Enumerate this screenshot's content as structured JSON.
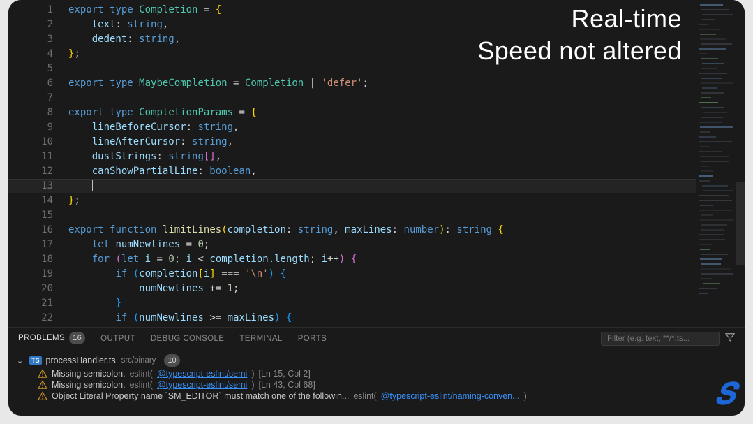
{
  "overlay": {
    "line1": "Real-time",
    "line2": "Speed not altered"
  },
  "editor": {
    "line_start": 1,
    "line_end": 22,
    "current_line": 13,
    "lines": [
      {
        "n": 1,
        "tokens": [
          [
            "kw",
            "export"
          ],
          [
            "punct",
            " "
          ],
          [
            "typekw",
            "type"
          ],
          [
            "punct",
            " "
          ],
          [
            "type",
            "Completion"
          ],
          [
            "punct",
            " = "
          ],
          [
            "bracket1",
            "{"
          ]
        ]
      },
      {
        "n": 2,
        "tokens": [
          [
            "punct",
            "    "
          ],
          [
            "ident",
            "text"
          ],
          [
            "punct",
            ": "
          ],
          [
            "typekw",
            "string"
          ],
          [
            "punct",
            ","
          ]
        ]
      },
      {
        "n": 3,
        "tokens": [
          [
            "punct",
            "    "
          ],
          [
            "ident",
            "dedent"
          ],
          [
            "punct",
            ": "
          ],
          [
            "typekw",
            "string"
          ],
          [
            "punct",
            ","
          ]
        ]
      },
      {
        "n": 4,
        "tokens": [
          [
            "bracket1",
            "}"
          ],
          [
            "punct",
            ";"
          ]
        ]
      },
      {
        "n": 5,
        "tokens": []
      },
      {
        "n": 6,
        "tokens": [
          [
            "kw",
            "export"
          ],
          [
            "punct",
            " "
          ],
          [
            "typekw",
            "type"
          ],
          [
            "punct",
            " "
          ],
          [
            "type",
            "MaybeCompletion"
          ],
          [
            "punct",
            " = "
          ],
          [
            "type",
            "Completion"
          ],
          [
            "punct",
            " | "
          ],
          [
            "str",
            "'defer'"
          ],
          [
            "punct",
            ";"
          ]
        ]
      },
      {
        "n": 7,
        "tokens": []
      },
      {
        "n": 8,
        "tokens": [
          [
            "kw",
            "export"
          ],
          [
            "punct",
            " "
          ],
          [
            "typekw",
            "type"
          ],
          [
            "punct",
            " "
          ],
          [
            "type",
            "CompletionParams"
          ],
          [
            "punct",
            " = "
          ],
          [
            "bracket1",
            "{"
          ]
        ]
      },
      {
        "n": 9,
        "tokens": [
          [
            "punct",
            "    "
          ],
          [
            "ident",
            "lineBeforeCursor"
          ],
          [
            "punct",
            ": "
          ],
          [
            "typekw",
            "string"
          ],
          [
            "punct",
            ","
          ]
        ]
      },
      {
        "n": 10,
        "tokens": [
          [
            "punct",
            "    "
          ],
          [
            "ident",
            "lineAfterCursor"
          ],
          [
            "punct",
            ": "
          ],
          [
            "typekw",
            "string"
          ],
          [
            "punct",
            ","
          ]
        ]
      },
      {
        "n": 11,
        "tokens": [
          [
            "punct",
            "    "
          ],
          [
            "ident",
            "dustStrings"
          ],
          [
            "punct",
            ": "
          ],
          [
            "typekw",
            "string"
          ],
          [
            "bracket2",
            "["
          ],
          [
            "bracket2",
            "]"
          ],
          [
            "punct",
            ","
          ]
        ]
      },
      {
        "n": 12,
        "tokens": [
          [
            "punct",
            "    "
          ],
          [
            "ident",
            "canShowPartialLine"
          ],
          [
            "punct",
            ": "
          ],
          [
            "typekw",
            "boolean"
          ],
          [
            "punct",
            ","
          ]
        ]
      },
      {
        "n": 13,
        "tokens": [
          [
            "punct",
            "    "
          ]
        ],
        "cursor": true
      },
      {
        "n": 14,
        "tokens": [
          [
            "bracket1",
            "}"
          ],
          [
            "punct",
            ";"
          ]
        ]
      },
      {
        "n": 15,
        "tokens": []
      },
      {
        "n": 16,
        "tokens": [
          [
            "kw",
            "export"
          ],
          [
            "punct",
            " "
          ],
          [
            "kw",
            "function"
          ],
          [
            "punct",
            " "
          ],
          [
            "fn",
            "limitLines"
          ],
          [
            "bracket1",
            "("
          ],
          [
            "ident",
            "completion"
          ],
          [
            "punct",
            ": "
          ],
          [
            "typekw",
            "string"
          ],
          [
            "punct",
            ", "
          ],
          [
            "ident",
            "maxLines"
          ],
          [
            "punct",
            ": "
          ],
          [
            "typekw",
            "number"
          ],
          [
            "bracket1",
            ")"
          ],
          [
            "punct",
            ": "
          ],
          [
            "typekw",
            "string"
          ],
          [
            "punct",
            " "
          ],
          [
            "bracket1",
            "{"
          ]
        ]
      },
      {
        "n": 17,
        "tokens": [
          [
            "punct",
            "    "
          ],
          [
            "kw",
            "let"
          ],
          [
            "punct",
            " "
          ],
          [
            "ident",
            "numNewlines"
          ],
          [
            "punct",
            " = "
          ],
          [
            "num",
            "0"
          ],
          [
            "punct",
            ";"
          ]
        ]
      },
      {
        "n": 18,
        "tokens": [
          [
            "punct",
            "    "
          ],
          [
            "kw",
            "for"
          ],
          [
            "punct",
            " "
          ],
          [
            "bracket2",
            "("
          ],
          [
            "kw",
            "let"
          ],
          [
            "punct",
            " "
          ],
          [
            "ident",
            "i"
          ],
          [
            "punct",
            " = "
          ],
          [
            "num",
            "0"
          ],
          [
            "punct",
            "; "
          ],
          [
            "ident",
            "i"
          ],
          [
            "punct",
            " < "
          ],
          [
            "ident",
            "completion"
          ],
          [
            "punct",
            "."
          ],
          [
            "ident",
            "length"
          ],
          [
            "punct",
            "; "
          ],
          [
            "ident",
            "i"
          ],
          [
            "punct",
            "++"
          ],
          [
            "bracket2",
            ")"
          ],
          [
            "punct",
            " "
          ],
          [
            "bracket2",
            "{"
          ]
        ]
      },
      {
        "n": 19,
        "tokens": [
          [
            "punct",
            "        "
          ],
          [
            "kw",
            "if"
          ],
          [
            "punct",
            " "
          ],
          [
            "bracket3",
            "("
          ],
          [
            "ident",
            "completion"
          ],
          [
            "bracket1",
            "["
          ],
          [
            "ident",
            "i"
          ],
          [
            "bracket1",
            "]"
          ],
          [
            "punct",
            " === "
          ],
          [
            "str",
            "'\\n'"
          ],
          [
            "bracket3",
            ")"
          ],
          [
            "punct",
            " "
          ],
          [
            "bracket3",
            "{"
          ]
        ]
      },
      {
        "n": 20,
        "tokens": [
          [
            "punct",
            "            "
          ],
          [
            "ident",
            "numNewlines"
          ],
          [
            "punct",
            " += "
          ],
          [
            "num",
            "1"
          ],
          [
            "punct",
            ";"
          ]
        ]
      },
      {
        "n": 21,
        "tokens": [
          [
            "punct",
            "        "
          ],
          [
            "bracket3",
            "}"
          ]
        ]
      },
      {
        "n": 22,
        "tokens": [
          [
            "punct",
            "        "
          ],
          [
            "kw",
            "if"
          ],
          [
            "punct",
            " "
          ],
          [
            "bracket3",
            "("
          ],
          [
            "ident",
            "numNewlines"
          ],
          [
            "punct",
            " >= "
          ],
          [
            "ident",
            "maxLines"
          ],
          [
            "bracket3",
            ")"
          ],
          [
            "punct",
            " "
          ],
          [
            "bracket3",
            "{"
          ]
        ]
      }
    ]
  },
  "panel": {
    "tabs": [
      {
        "id": "problems",
        "label": "PROBLEMS",
        "badge": "16",
        "active": true
      },
      {
        "id": "output",
        "label": "OUTPUT"
      },
      {
        "id": "debug",
        "label": "DEBUG CONSOLE"
      },
      {
        "id": "terminal",
        "label": "TERMINAL"
      },
      {
        "id": "ports",
        "label": "PORTS"
      }
    ],
    "filter_placeholder": "Filter (e.g. text, **/*.ts...",
    "file": {
      "name": "processHandler.ts",
      "path": "src/binary",
      "count": "10"
    },
    "problems": [
      {
        "msg": "Missing semicolon.",
        "source": "eslint",
        "rule": "@typescript-eslint/semi",
        "loc": "[Ln 15, Col 2]"
      },
      {
        "msg": "Missing semicolon.",
        "source": "eslint",
        "rule": "@typescript-eslint/semi",
        "loc": "[Ln 43, Col 68]"
      },
      {
        "msg": "Object Literal Property name `SM_EDITOR` must match one of the followin...",
        "source": "eslint",
        "rule": "@typescript-eslint/naming-conven...",
        "loc": ""
      }
    ]
  }
}
